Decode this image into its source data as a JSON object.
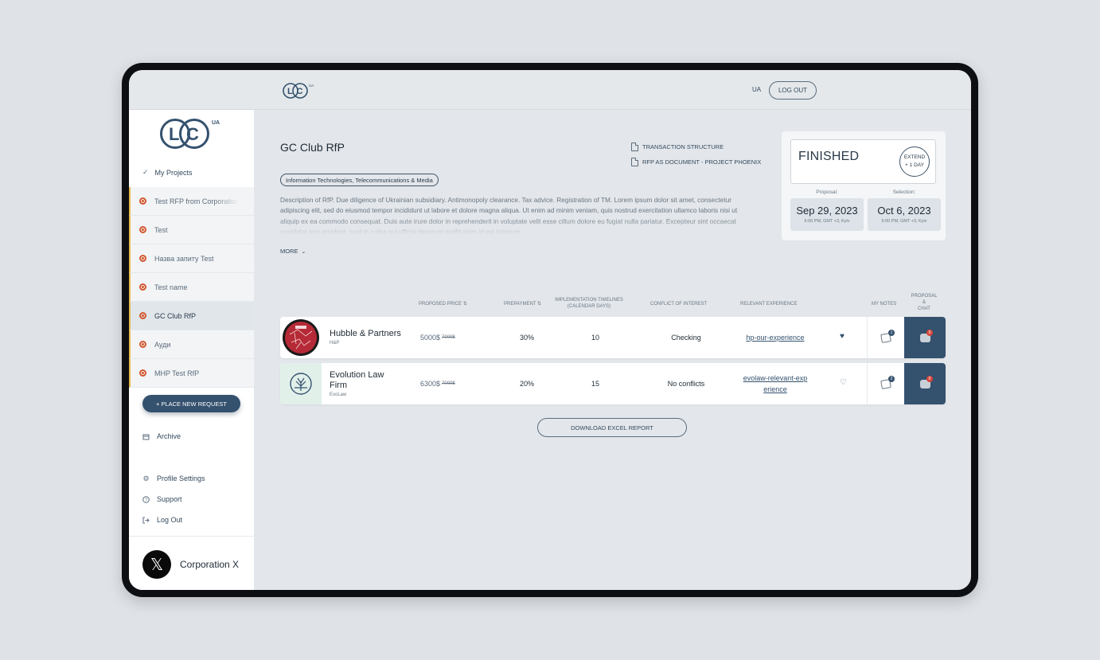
{
  "topbar": {
    "logo_sup": "UA",
    "language": "UA",
    "logout_label": "LOG OUT"
  },
  "sidebar": {
    "logo_sup": "UA",
    "my_projects": "My Projects",
    "projects": [
      {
        "label": "Test RFP from Corporation X"
      },
      {
        "label": "Test"
      },
      {
        "label": "Назва запиту Test"
      },
      {
        "label": "Test name"
      },
      {
        "label": "GC Club RfP"
      },
      {
        "label": "Ауди"
      },
      {
        "label": "MHP Test RfP"
      }
    ],
    "place_request": "+ PLACE NEW REQUEST",
    "archive": "Archive",
    "profile_settings": "Profile Settings",
    "support": "Support",
    "logout": "Log Out",
    "user_initial": "𝕏",
    "user_name": "Corporation X"
  },
  "rfp": {
    "title": "GC Club RfP",
    "doc_links": [
      "TRANSACTION STRUCTURE",
      "RFP AS DOCUMENT - PROJECT PHOENIX"
    ],
    "tag": "Information Technologies, Telecommunications & Media",
    "description": "Description of RfP. Due diligence of Ukrainian subsidiary. Antimonopoly clearance. Tax advice. Registration of TM. Lorem ipsum dolor sit amet, consectetur adipiscing elit, sed do eiusmod tempor incididunt ut labore et dolore magna aliqua. Ut enim ad minim veniam, quis nostrud exercitation ullamco laboris nisi ut aliquip ex ea commodo consequat. Duis aute irure dolor in reprehenderit in voluptate velit esse cillum dolore eu fugiat nulla pariatur. Excepteur sint occaecat cupidatat non proident, sunt in culpa qui officia deserunt mollit anim id est laborum.",
    "more": "MORE"
  },
  "status": {
    "state": "FINISHED",
    "extend_line1": "EXTEND",
    "extend_line2": "+ 1 DAY",
    "proposal_caption": "Proposal:",
    "proposal_date": "Sep 29, 2023",
    "proposal_time": "6:00 PM, GMT +3, Kyiv",
    "selection_caption": "Selection:",
    "selection_date": "Oct 6, 2023",
    "selection_time": "5:00 PM, GMT +3, Kyiv"
  },
  "table": {
    "headers": {
      "price": "PROPOSED PRICE",
      "prepayment": "PREPAYMENT",
      "timelines_1": "IMPLEMENTATION TIMELINES",
      "timelines_2": "(CALENDAR DAYS)",
      "conflict": "CONFLICT OF INTEREST",
      "experience": "RELEVANT EXPERIENCE",
      "notes": "MY NOTES",
      "chat_1": "PROPOSAL",
      "chat_2": "&",
      "chat_3": "CHAT"
    },
    "rows": [
      {
        "name": "Hubble & Partners",
        "short": "H&P",
        "price": "5000$",
        "old_price": "7000$",
        "prepayment": "30%",
        "timeline": "10",
        "conflict": "Checking",
        "experience": "hp-our-experience",
        "favorite": true,
        "notes_count": "1",
        "chat_count": "0"
      },
      {
        "name": "Evolution Law Firm",
        "short": "EvoLaw",
        "price": "6300$",
        "old_price": "7000$",
        "prepayment": "20%",
        "timeline": "15",
        "conflict": "No conflicts",
        "experience": "evolaw-relevant-experience",
        "favorite": false,
        "notes_count": "2",
        "chat_count": "0"
      }
    ],
    "download": "DOWNLOAD EXCEL REPORT"
  },
  "colors": {
    "accent": "#34516e",
    "project_marker": "#e6b84c",
    "alert": "#d6463a"
  }
}
